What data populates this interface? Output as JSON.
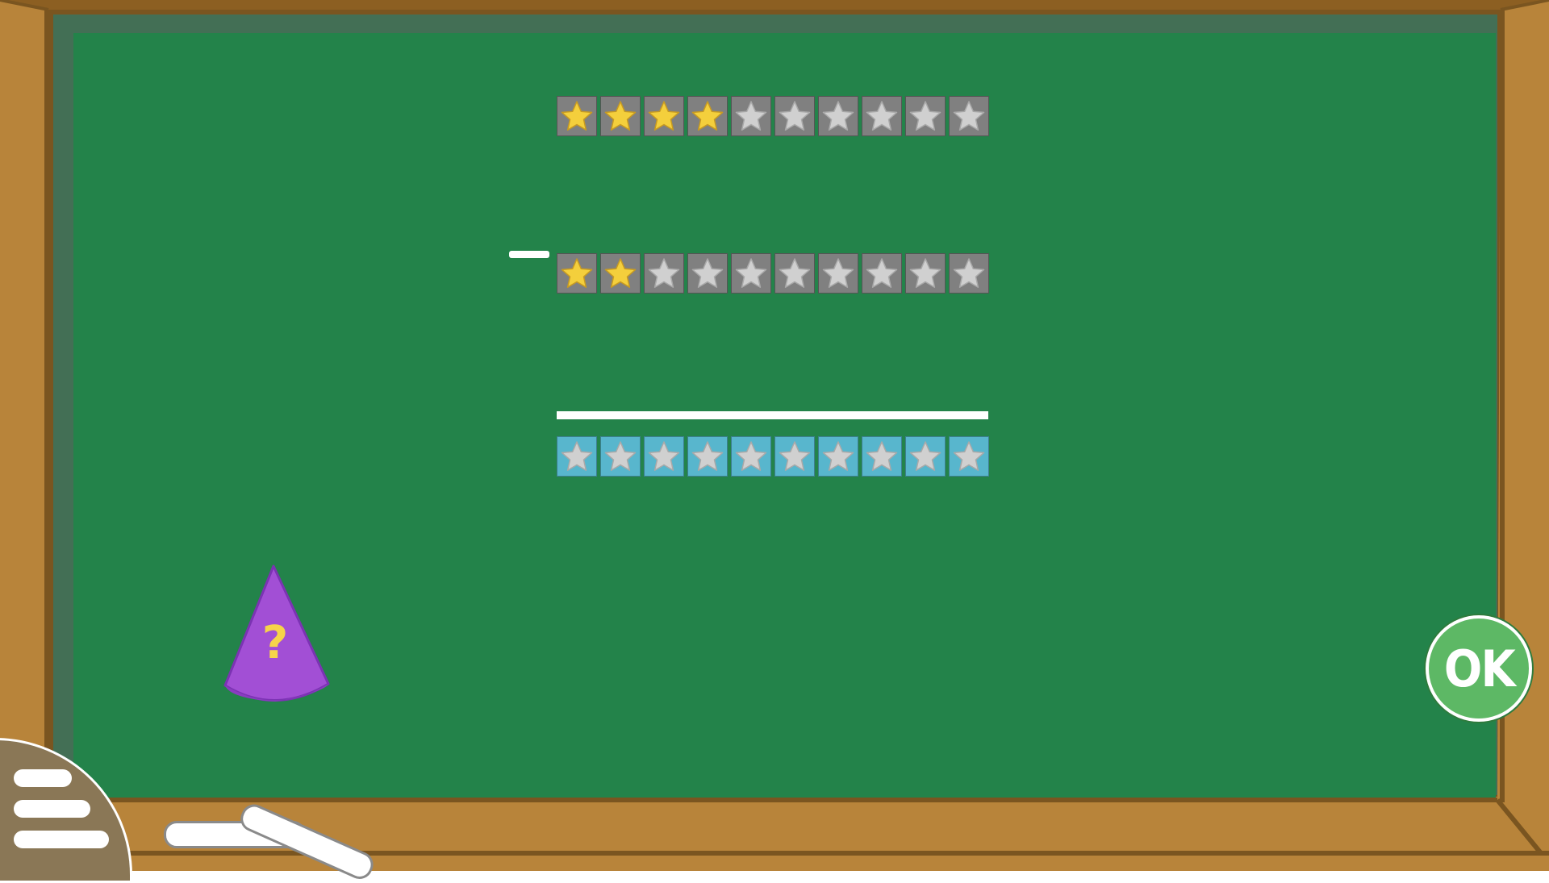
{
  "game": {
    "minuend_filled": 4,
    "subtrahend_filled": 2,
    "total_stars_per_row": 10,
    "answer_filled": 0
  },
  "buttons": {
    "ok_label": "OK",
    "hint_symbol": "?"
  },
  "icons": {
    "menu": "menu-icon",
    "hint": "wizard-hat-icon",
    "star": "star-icon"
  },
  "colors": {
    "board": "#23834a",
    "frame": "#b8843a",
    "star_filled": "#f4cf3c",
    "star_empty": "#d0d0d0",
    "cell_top": "#808080",
    "cell_answer": "#58b6cd",
    "ok_button": "#5db865",
    "hat": "#a24fd5"
  }
}
